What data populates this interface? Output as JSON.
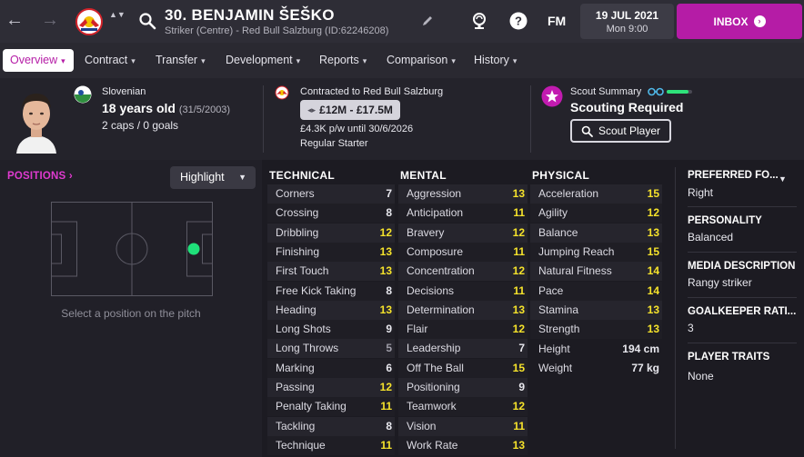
{
  "header": {
    "back_arrow": "←",
    "forward_arrow": "→",
    "club_switch": "▲▼",
    "player_title": "30. BENJAMIN ŠEŠKO",
    "player_subtitle": "Striker (Centre) - Red Bull Salzburg (ID:62246208)",
    "fm_label": "FM",
    "date_line1": "19 JUL 2021",
    "date_line2": "Mon 9:00",
    "inbox_label": "INBOX",
    "inbox_arrow": "›"
  },
  "tabs": [
    {
      "label": "Overview",
      "active": true
    },
    {
      "label": "Contract"
    },
    {
      "label": "Transfer"
    },
    {
      "label": "Development"
    },
    {
      "label": "Reports"
    },
    {
      "label": "Comparison"
    },
    {
      "label": "History"
    }
  ],
  "info": {
    "nationality": "Slovenian",
    "age": "18 years old",
    "dob": "(31/5/2003)",
    "caps": "2 caps / 0 goals",
    "contract_title": "Contracted to Red Bull Salzburg",
    "value_range": "£12M - £17.5M",
    "value_switch": "◂▸",
    "wage": "£4.3K p/w until 30/6/2026",
    "squad_status": "Regular Starter",
    "scout_label": "Scout Summary",
    "scout_knowledge": 0.85,
    "scout_status": "Scouting Required",
    "scout_button": "Scout Player"
  },
  "positions": {
    "title": "POSITIONS ›",
    "highlight_label": "Highlight",
    "hint": "Select a position on the pitch"
  },
  "technical": {
    "heading": "TECHNICAL",
    "rows": [
      {
        "name": "Corners",
        "value": "7"
      },
      {
        "name": "Crossing",
        "value": "8"
      },
      {
        "name": "Dribbling",
        "value": "12"
      },
      {
        "name": "Finishing",
        "value": "13"
      },
      {
        "name": "First Touch",
        "value": "13"
      },
      {
        "name": "Free Kick Taking",
        "value": "8"
      },
      {
        "name": "Heading",
        "value": "13"
      },
      {
        "name": "Long Shots",
        "value": "9"
      },
      {
        "name": "Long Throws",
        "value": "5"
      },
      {
        "name": "Marking",
        "value": "6"
      },
      {
        "name": "Passing",
        "value": "12"
      },
      {
        "name": "Penalty Taking",
        "value": "11"
      },
      {
        "name": "Tackling",
        "value": "8"
      },
      {
        "name": "Technique",
        "value": "11"
      }
    ]
  },
  "mental": {
    "heading": "MENTAL",
    "rows": [
      {
        "name": "Aggression",
        "value": "13"
      },
      {
        "name": "Anticipation",
        "value": "11"
      },
      {
        "name": "Bravery",
        "value": "12"
      },
      {
        "name": "Composure",
        "value": "11"
      },
      {
        "name": "Concentration",
        "value": "12"
      },
      {
        "name": "Decisions",
        "value": "11"
      },
      {
        "name": "Determination",
        "value": "13"
      },
      {
        "name": "Flair",
        "value": "12"
      },
      {
        "name": "Leadership",
        "value": "7"
      },
      {
        "name": "Off The Ball",
        "value": "15"
      },
      {
        "name": "Positioning",
        "value": "9"
      },
      {
        "name": "Teamwork",
        "value": "12"
      },
      {
        "name": "Vision",
        "value": "11"
      },
      {
        "name": "Work Rate",
        "value": "13"
      }
    ]
  },
  "physical": {
    "heading": "PHYSICAL",
    "rows": [
      {
        "name": "Acceleration",
        "value": "15"
      },
      {
        "name": "Agility",
        "value": "12"
      },
      {
        "name": "Balance",
        "value": "13"
      },
      {
        "name": "Jumping Reach",
        "value": "15"
      },
      {
        "name": "Natural Fitness",
        "value": "14"
      },
      {
        "name": "Pace",
        "value": "14"
      },
      {
        "name": "Stamina",
        "value": "13"
      },
      {
        "name": "Strength",
        "value": "13"
      }
    ],
    "height_label": "Height",
    "height_value": "194 cm",
    "weight_label": "Weight",
    "weight_value": "77 kg"
  },
  "right_panel": {
    "preferred_foot_head": "PREFERRED FO...",
    "preferred_foot_value": "Right",
    "personality_head": "PERSONALITY",
    "personality_value": "Balanced",
    "media_head": "MEDIA DESCRIPTION",
    "media_value": "Rangy striker",
    "gk_head": "GOALKEEPER RATI...",
    "gk_value": "3",
    "traits_head": "PLAYER TRAITS",
    "traits_value": "None"
  },
  "colors": {
    "accent": "#b51ca6",
    "positions_title": "#e03ad0",
    "high_attr": "#f6e32b",
    "scout_bar": "#2ee27a",
    "position_dot": "#1fe07a"
  },
  "icons": [
    "back-arrow-icon",
    "forward-arrow-icon",
    "club-badge-icon",
    "search-icon",
    "edit-icon",
    "trophy-icon",
    "help-icon",
    "inbox-arrow-icon",
    "flag-icon",
    "star-icon",
    "binoculars-icon",
    "magnifier-icon"
  ]
}
